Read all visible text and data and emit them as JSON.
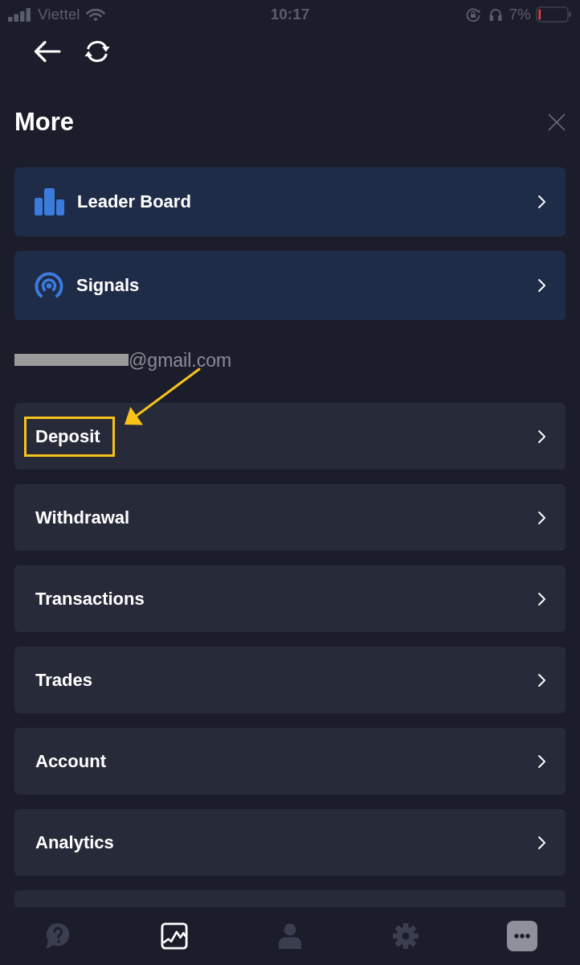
{
  "status_bar": {
    "carrier": "Viettel",
    "time": "10:17",
    "battery": "7%"
  },
  "panel": {
    "title": "More"
  },
  "featured": [
    {
      "kind": "leaderboard",
      "label": "Leader Board"
    },
    {
      "kind": "signals",
      "label": "Signals"
    }
  ],
  "account": {
    "email": "@gmail.com",
    "redacted": true
  },
  "menu": [
    {
      "label": "Deposit",
      "highlighted": true
    },
    {
      "label": "Withdrawal",
      "highlighted": false
    },
    {
      "label": "Transactions",
      "highlighted": false
    },
    {
      "label": "Trades",
      "highlighted": false
    },
    {
      "label": "Account",
      "highlighted": false
    },
    {
      "label": "Analytics",
      "highlighted": false
    }
  ],
  "nav": [
    {
      "kind": "help",
      "selected": false,
      "active": false
    },
    {
      "kind": "chart",
      "selected": false,
      "active": true
    },
    {
      "kind": "profile",
      "selected": false,
      "active": false
    },
    {
      "kind": "settings",
      "selected": false,
      "active": false
    },
    {
      "kind": "more",
      "selected": true,
      "active": false
    }
  ]
}
